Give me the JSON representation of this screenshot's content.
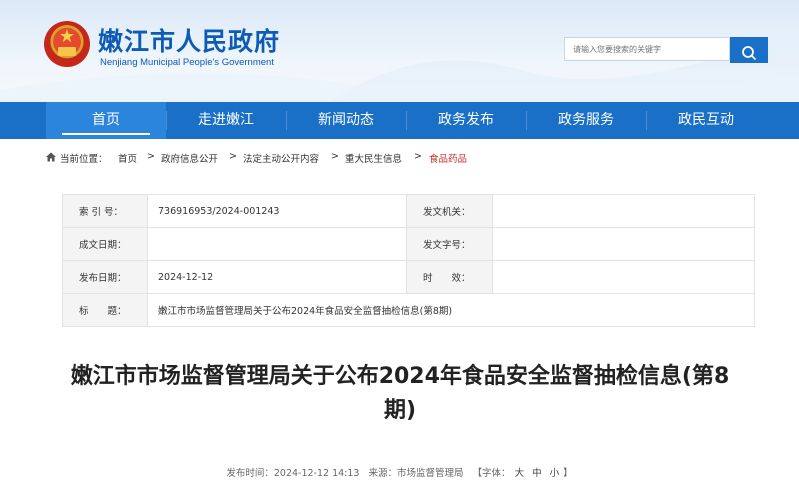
{
  "header": {
    "title": "嫩江市人民政府",
    "subtitle": "Nenjiang Municipal People's Government",
    "search_placeholder": "请输入您要搜索的关键字"
  },
  "nav": {
    "items": [
      {
        "label": "首页"
      },
      {
        "label": "走进嫩江"
      },
      {
        "label": "新闻动态"
      },
      {
        "label": "政务发布"
      },
      {
        "label": "政务服务"
      },
      {
        "label": "政民互动"
      }
    ]
  },
  "breadcrumb": {
    "prefix": "当前位置：",
    "items": [
      "首页",
      "政府信息公开",
      "法定主动公开内容",
      "重大民生信息",
      "食品药品"
    ],
    "separator": ">"
  },
  "info": {
    "index_label": "索 引 号：",
    "index_value": "736916953/2024-001243",
    "issuer_label": "发文机关：",
    "issuer_value": "",
    "created_label": "成文日期：",
    "created_value": "",
    "docno_label": "发文字号：",
    "docno_value": "",
    "published_label": "发布日期：",
    "published_value": "2024-12-12",
    "validity_label": "时　　效：",
    "validity_value": "",
    "subject_label": "标　　题：",
    "subject_value": "嫩江市市场监督管理局关于公布2024年食品安全监督抽检信息(第8期)"
  },
  "article": {
    "title": "嫩江市市场监督管理局关于公布2024年食品安全监督抽检信息(第8期)",
    "published": "发布时间：2024-12-12 14:13",
    "source": "来源：市场监督管理局",
    "font_prefix": "【字体：",
    "font_large": "大",
    "font_medium": "中",
    "font_small": "小",
    "font_suffix": "】"
  },
  "colors": {
    "primary": "#1a6fc7",
    "nav_active": "#2c85dc",
    "brand_text": "#0d5bb5",
    "breadcrumb_current": "#c9302c"
  }
}
